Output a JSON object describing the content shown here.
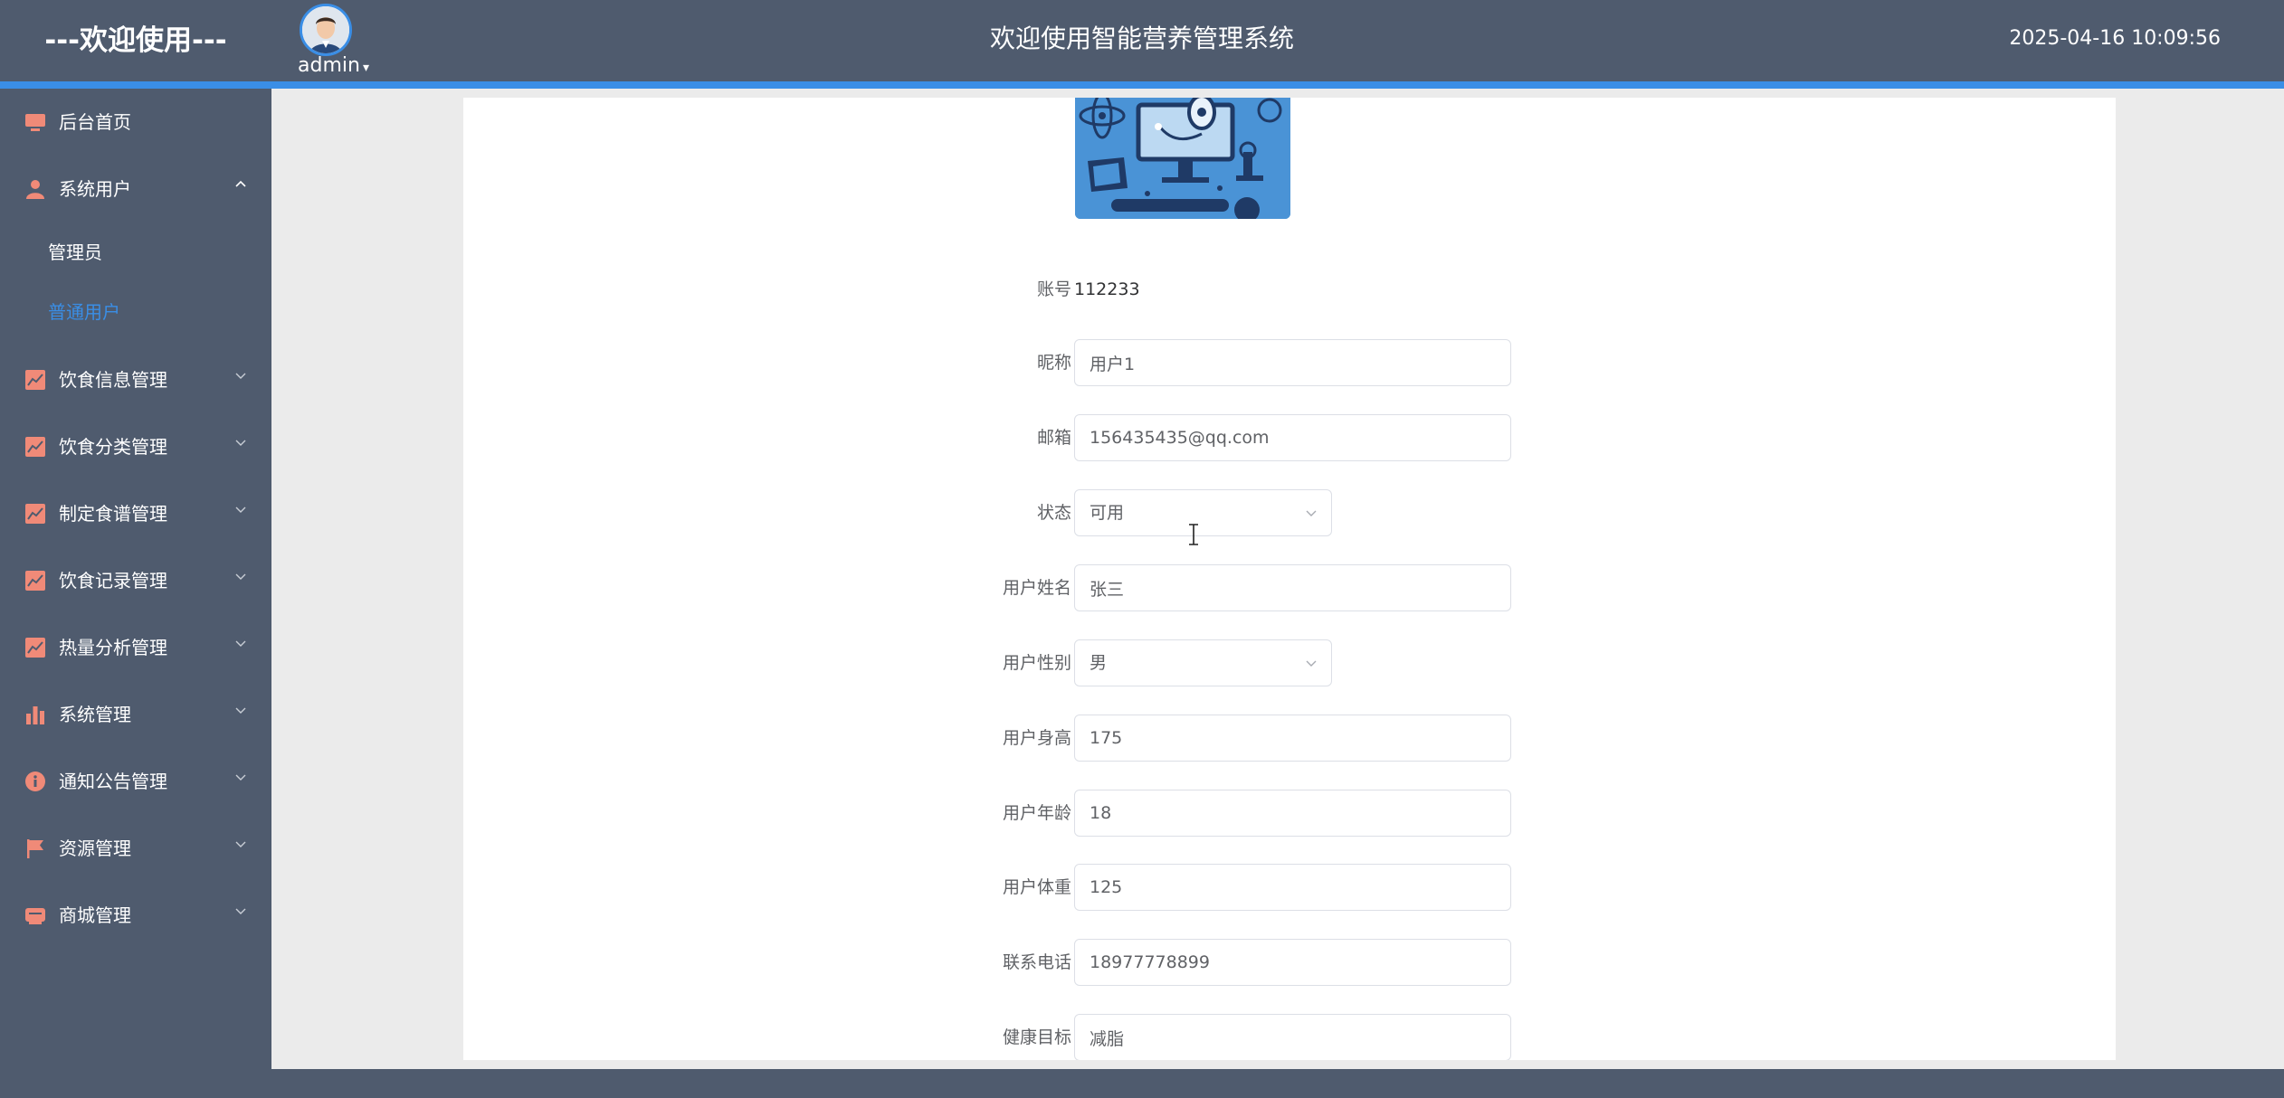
{
  "header": {
    "brand": "---欢迎使用---",
    "username": "admin",
    "title": "欢迎使用智能营养管理系统",
    "datetime": "2025-04-16 10:09:56"
  },
  "sidebar": {
    "items": [
      {
        "label": "后台首页",
        "icon": "monitor-icon"
      },
      {
        "label": "系统用户",
        "icon": "user-icon",
        "expanded": true,
        "children": [
          {
            "label": "管理员"
          },
          {
            "label": "普通用户",
            "active": true
          }
        ]
      },
      {
        "label": "饮食信息管理",
        "icon": "chart-line-icon"
      },
      {
        "label": "饮食分类管理",
        "icon": "chart-line-icon"
      },
      {
        "label": "制定食谱管理",
        "icon": "chart-line-icon"
      },
      {
        "label": "饮食记录管理",
        "icon": "chart-line-icon"
      },
      {
        "label": "热量分析管理",
        "icon": "chart-line-icon"
      },
      {
        "label": "系统管理",
        "icon": "bar-chart-icon"
      },
      {
        "label": "通知公告管理",
        "icon": "info-icon"
      },
      {
        "label": "资源管理",
        "icon": "flag-icon"
      },
      {
        "label": "商城管理",
        "icon": "shop-icon"
      }
    ]
  },
  "form": {
    "account": {
      "label": "账号",
      "value": "112233"
    },
    "nickname": {
      "label": "昵称",
      "value": "用户1"
    },
    "email": {
      "label": "邮箱",
      "value": "156435435@qq.com"
    },
    "status": {
      "label": "状态",
      "value": "可用"
    },
    "name": {
      "label": "用户姓名",
      "value": "张三"
    },
    "gender": {
      "label": "用户性别",
      "value": "男"
    },
    "height": {
      "label": "用户身高",
      "value": "175"
    },
    "age": {
      "label": "用户年龄",
      "value": "18"
    },
    "weight": {
      "label": "用户体重",
      "value": "125"
    },
    "phone": {
      "label": "联系电话",
      "value": "18977778899"
    },
    "goal": {
      "label": "健康目标",
      "value": "减脂"
    }
  },
  "colors": {
    "header_bg": "#4f5b6e",
    "accent": "#3a8ee6",
    "icon_accent": "#f08a78",
    "content_bg": "#ebebeb"
  }
}
